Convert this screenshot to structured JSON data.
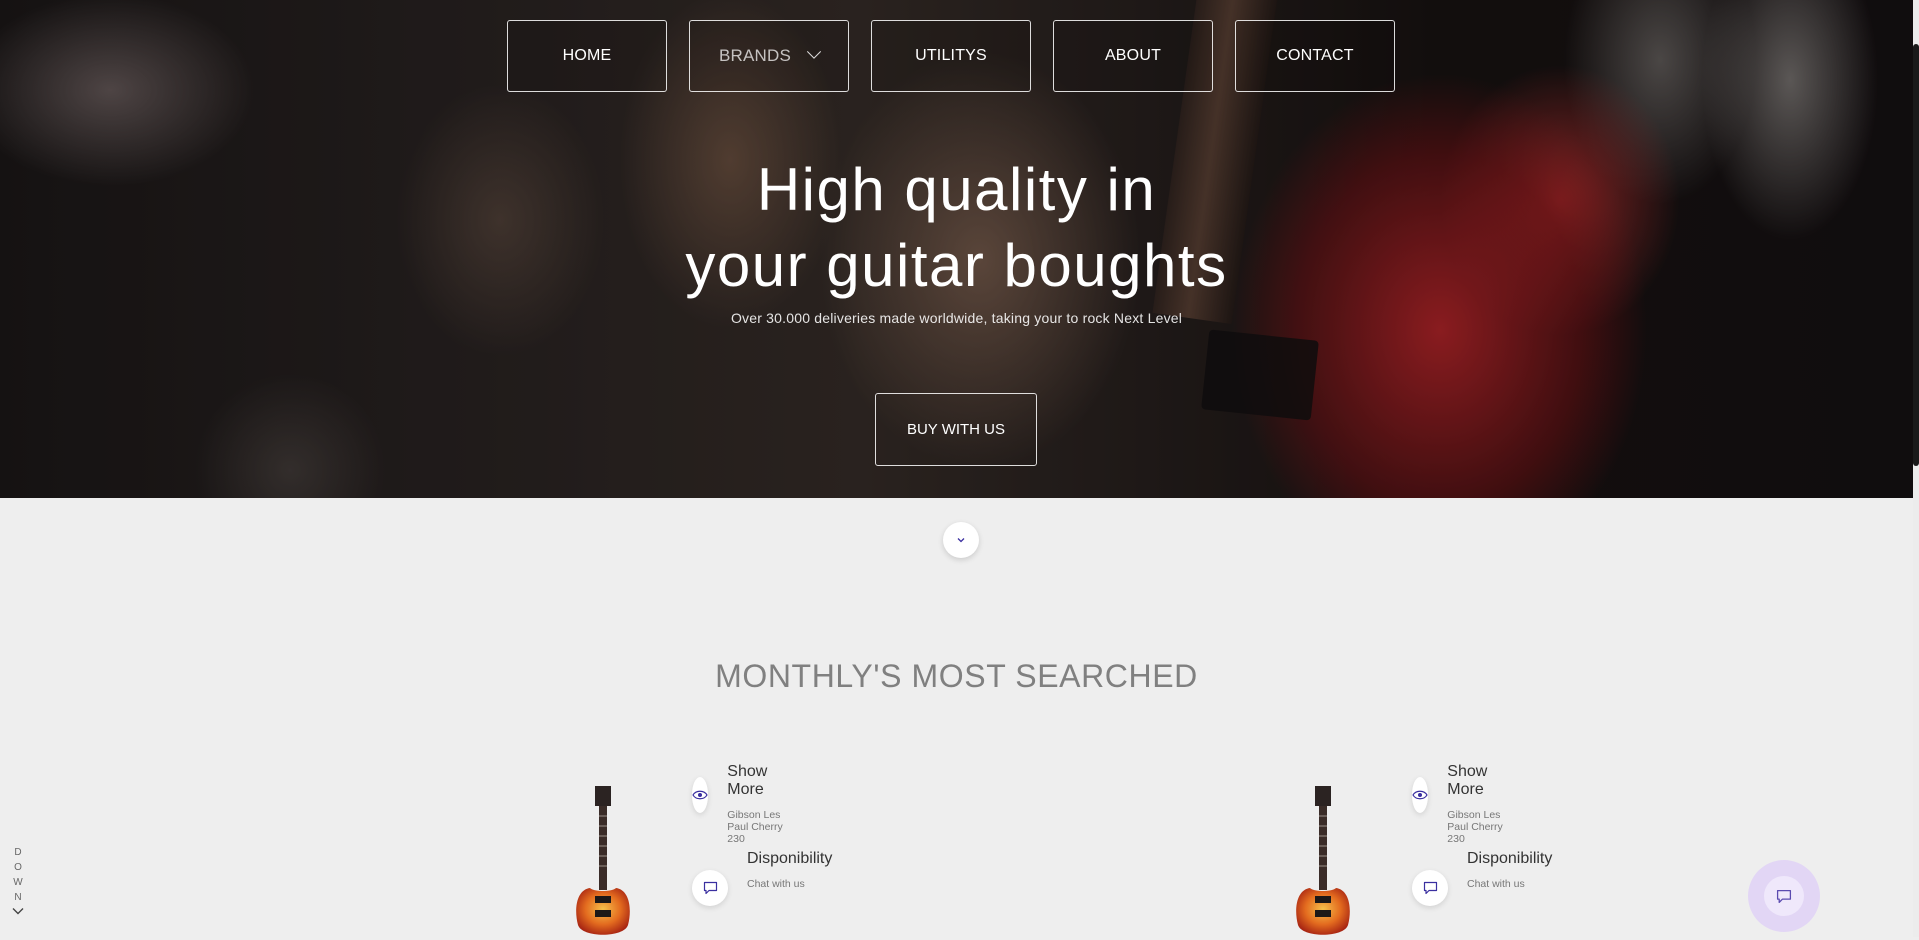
{
  "nav": {
    "items": [
      {
        "label": "HOME"
      },
      {
        "label": "BRANDS"
      },
      {
        "label": "UTILITYS"
      },
      {
        "label": "ABOUT"
      },
      {
        "label": "CONTACT"
      }
    ]
  },
  "hero": {
    "headline_line1": "High quality in",
    "headline_line2": "your guitar boughts",
    "subline": "Over 30.000 deliveries made worldwide, taking your to rock Next Level",
    "cta_label": "BUY WITH US"
  },
  "section": {
    "title": "MONTHLY'S MOST SEARCHED"
  },
  "products": [
    {
      "features": [
        {
          "icon": "eye-icon",
          "title": "Show More",
          "subtitle": "Gibson Les Paul Cherry 230"
        },
        {
          "icon": "chat-icon",
          "title": "Disponibility",
          "subtitle": "Chat with us"
        }
      ]
    },
    {
      "features": [
        {
          "icon": "eye-icon",
          "title": "Show More",
          "subtitle": "Gibson Les Paul Cherry 230"
        },
        {
          "icon": "chat-icon",
          "title": "Disponibility",
          "subtitle": "Chat with us"
        }
      ]
    }
  ],
  "side_scroll": {
    "letters": [
      "D",
      "O",
      "W",
      "N"
    ]
  },
  "colors": {
    "accent_icon": "#3a2fa0",
    "page_bg": "#eeeeee",
    "title_gray": "#808080",
    "chat_fab_bg": "#e2d6f5"
  }
}
